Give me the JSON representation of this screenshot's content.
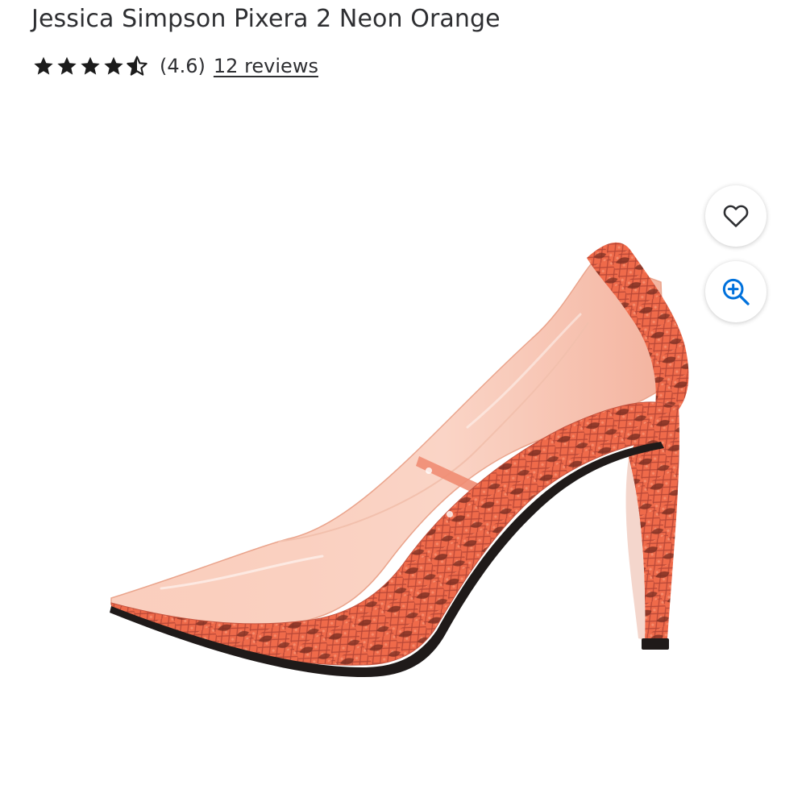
{
  "product": {
    "title": "Jessica Simpson Pixera 2 Neon Orange",
    "rating": {
      "stars": 4.5,
      "value_label": "(4.6)",
      "reviews_label": "12 reviews"
    }
  },
  "image": {
    "subject": "orange-snakeskin-pvc-pump-shoe",
    "colors": {
      "snakeskin": "#ef6a4a",
      "snakeskin_dark": "#7a2e22",
      "pvc": "#f7b79f",
      "sole": "#1f1a19"
    }
  },
  "actions": {
    "favorite_icon": "heart-icon",
    "zoom_icon": "zoom-in-icon",
    "accent": "#0071dc"
  }
}
